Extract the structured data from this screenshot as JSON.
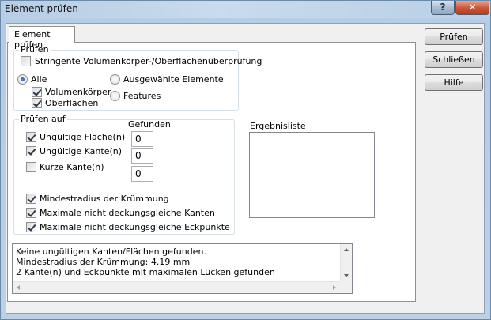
{
  "window": {
    "title": "Element prüfen",
    "help_glyph": "?",
    "close_glyph": "✕"
  },
  "tab": {
    "label": "Element prüfen"
  },
  "buttons": {
    "check": "Prüfen",
    "close": "Schließen",
    "help": "Hilfe"
  },
  "pruefen_group": {
    "title": "Prüfen",
    "strict_check": {
      "label": "Stringente Volumenkörper-/Oberflächenüberprüfung",
      "checked": false
    },
    "all": {
      "label": "Alle",
      "selected": true
    },
    "solids": {
      "label": "Volumenkörper",
      "checked": true
    },
    "surfaces": {
      "label": "Oberflächen",
      "checked": true
    },
    "selected_elements": {
      "label": "Ausgewählte Elemente",
      "selected": false
    },
    "features": {
      "label": "Features",
      "selected": false
    }
  },
  "pruefen_auf_group": {
    "title": "Prüfen auf",
    "found_header": "Gefunden",
    "invalid_faces": {
      "label": "Ungültige Fläche(n)",
      "checked": true,
      "found": "0"
    },
    "invalid_edges": {
      "label": "Ungültige Kante(n)",
      "checked": true,
      "found": "0"
    },
    "short_edges": {
      "label": "Kurze Kante(n)",
      "checked": false,
      "found": "0"
    },
    "min_curvature": {
      "label": "Mindestradius der Krümmung",
      "checked": true
    },
    "max_gap_edges": {
      "label": "Maximale nicht deckungsgleiche Kanten",
      "checked": true
    },
    "max_gap_vertices": {
      "label": "Maximale nicht deckungsgleiche Eckpunkte",
      "checked": true
    }
  },
  "result_list": {
    "label": "Ergebnisliste"
  },
  "messages": {
    "line1": "Keine ungültigen Kanten/Flächen gefunden.",
    "line2": "Mindestradius der Krümmung: 4.19 mm",
    "line3": "2 Kante(n) und Eckpunkte mit maximalen Lücken gefunden"
  }
}
